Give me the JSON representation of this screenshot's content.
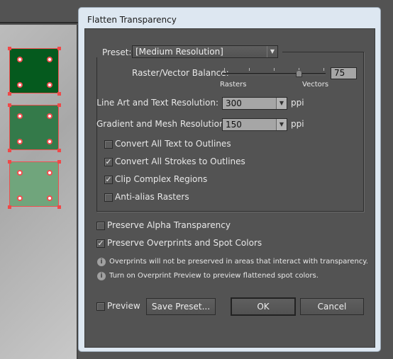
{
  "dialog": {
    "title": "Flatten Transparency"
  },
  "preset": {
    "label": "Preset:",
    "value": "[Medium Resolution]"
  },
  "balance": {
    "label": "Raster/Vector Balance:",
    "value": "75",
    "percent": 75,
    "min_label": "Rasters",
    "max_label": "Vectors"
  },
  "line_art": {
    "label": "Line Art and Text Resolution:",
    "value": "300",
    "unit": "ppi"
  },
  "gradient": {
    "label": "Gradient and Mesh Resolution:",
    "value": "150",
    "unit": "ppi"
  },
  "options": [
    {
      "label": "Convert All Text to Outlines",
      "checked": false
    },
    {
      "label": "Convert All Strokes to Outlines",
      "checked": true
    },
    {
      "label": "Clip Complex Regions",
      "checked": true
    },
    {
      "label": "Anti-alias Rasters",
      "checked": false
    }
  ],
  "preserve_alpha": {
    "label": "Preserve Alpha Transparency",
    "checked": false
  },
  "preserve_overprints": {
    "label": "Preserve Overprints and Spot Colors",
    "checked": true
  },
  "notes": [
    "Overprints will not be preserved in areas that interact with transparency.",
    "Turn on Overprint Preview to preview flattened spot colors."
  ],
  "preview": {
    "label": "Preview",
    "checked": false
  },
  "buttons": {
    "save_preset": "Save Preset...",
    "ok": "OK",
    "cancel": "Cancel"
  },
  "artwork": {
    "colors": [
      "#055a1e",
      "#347a4a",
      "#70a57c"
    ],
    "selection_color": "#f05050"
  }
}
